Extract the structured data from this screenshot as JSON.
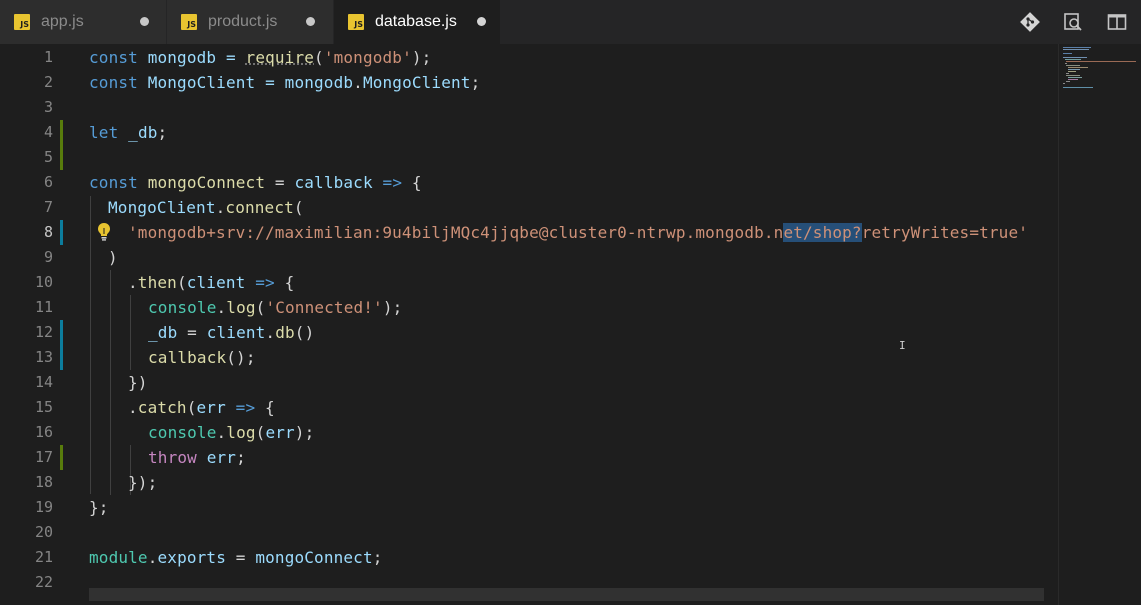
{
  "tabs": [
    {
      "label": "app.js",
      "icon": "JS",
      "modified": true,
      "active": false
    },
    {
      "label": "product.js",
      "icon": "JS",
      "modified": true,
      "active": false
    },
    {
      "label": "database.js",
      "icon": "JS",
      "modified": true,
      "active": true
    }
  ],
  "actions": [
    "git-compare-icon",
    "open-preview-icon",
    "split-editor-icon"
  ],
  "line_numbers": [
    "1",
    "2",
    "3",
    "4",
    "5",
    "6",
    "7",
    "8",
    "9",
    "10",
    "11",
    "12",
    "13",
    "14",
    "15",
    "16",
    "17",
    "18",
    "19",
    "20",
    "21",
    "22"
  ],
  "current_line": "8",
  "code": {
    "l1": {
      "a": "const",
      "b": " mongodb = ",
      "c": "require",
      "d": "(",
      "e": "'mongodb'",
      "f": ");"
    },
    "l2": {
      "a": "const",
      "b": " MongoClient = ",
      "c": "mongodb",
      "d": ".",
      "e": "MongoClient",
      "f": ";"
    },
    "l4": {
      "a": "let",
      "b": " ",
      "c": "_db",
      "d": ";"
    },
    "l6": {
      "a": "const",
      "b": " ",
      "c": "mongoConnect",
      "d": " = ",
      "e": "callback",
      "f": " ",
      "g": "=>",
      "h": " {"
    },
    "l7": {
      "a": "MongoClient",
      "b": ".",
      "c": "connect",
      "d": "("
    },
    "l8": {
      "a": "'mongodb+srv://maximilian:9u4biljMQc4jjqbe@cluster0-ntrwp.mongodb.n",
      "b": "et/shop?",
      "c": "retryWrites=true'"
    },
    "l9": {
      "a": ")"
    },
    "l10": {
      "a": ".",
      "b": "then",
      "c": "(",
      "d": "client",
      "e": " ",
      "f": "=>",
      "g": " {"
    },
    "l11": {
      "a": "console",
      "b": ".",
      "c": "log",
      "d": "(",
      "e": "'Connected!'",
      "f": ");"
    },
    "l12": {
      "a": "_db",
      "b": " = ",
      "c": "client",
      "d": ".",
      "e": "db",
      "f": "()"
    },
    "l13": {
      "a": "callback",
      "b": "();"
    },
    "l14": {
      "a": "})"
    },
    "l15": {
      "a": ".",
      "b": "catch",
      "c": "(",
      "d": "err",
      "e": " ",
      "f": "=>",
      "g": " {"
    },
    "l16": {
      "a": "console",
      "b": ".",
      "c": "log",
      "d": "(",
      "e": "err",
      "f": ");"
    },
    "l17": {
      "a": "throw",
      "b": " ",
      "c": "err",
      "d": ";"
    },
    "l18": {
      "a": "});"
    },
    "l19": {
      "a": "};"
    },
    "l21": {
      "a": "module",
      "b": ".",
      "c": "exports",
      "d": " = ",
      "e": "mongoConnect",
      "f": ";"
    }
  },
  "colors": {
    "keyword": "#569cd6",
    "variable": "#9cdcfe",
    "class": "#4ec9b0",
    "function": "#dcdcaa",
    "string": "#ce9178",
    "control": "#c586c0"
  }
}
